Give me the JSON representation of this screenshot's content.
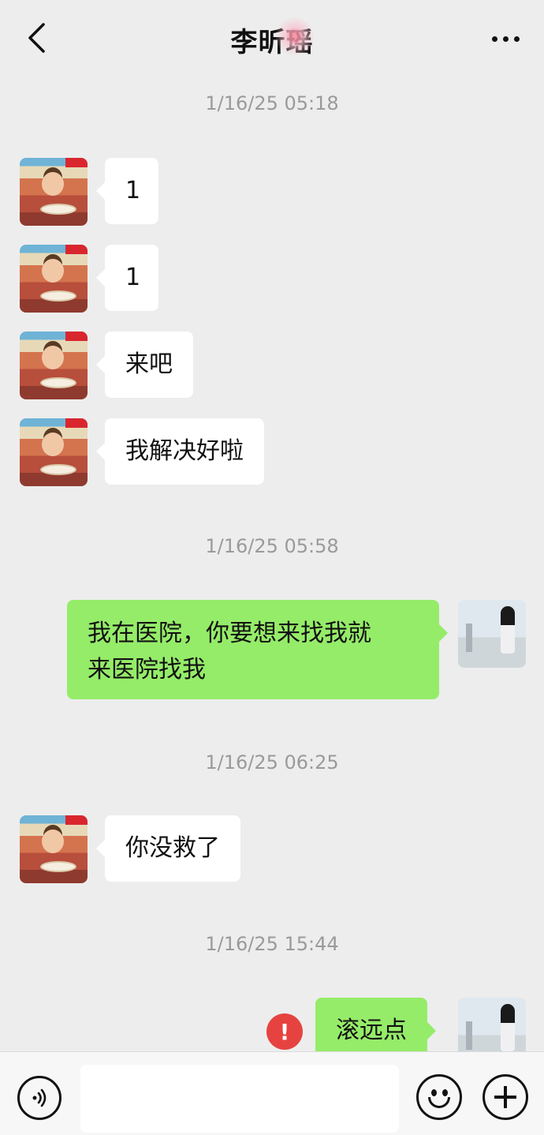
{
  "header": {
    "title_visible": "李昕",
    "title_obscured": "瑶"
  },
  "messages": [
    {
      "timestamp": "1/16/25 05:18"
    },
    {
      "side": "left",
      "text": "1"
    },
    {
      "side": "left",
      "text": "1"
    },
    {
      "side": "left",
      "text": "来吧"
    },
    {
      "side": "left",
      "text": "我解决好啦"
    },
    {
      "timestamp": "1/16/25 05:58"
    },
    {
      "side": "right",
      "lines": [
        "我在医院，你要想来找我就",
        "来医院找我"
      ]
    },
    {
      "timestamp": "1/16/25 06:25"
    },
    {
      "side": "left",
      "text": "你没救了"
    },
    {
      "timestamp": "1/16/25 15:44"
    },
    {
      "side": "right",
      "text": "滚远点",
      "status": "failed",
      "status_symbol": "!"
    }
  ],
  "input": {
    "value": ""
  },
  "colors": {
    "background": "#ededed",
    "left_bubble": "#ffffff",
    "right_bubble": "#95ec69",
    "error": "#e64340"
  },
  "icons": [
    "back-icon",
    "more-icon",
    "voice-icon",
    "emoji-icon",
    "plus-icon",
    "error-icon"
  ]
}
